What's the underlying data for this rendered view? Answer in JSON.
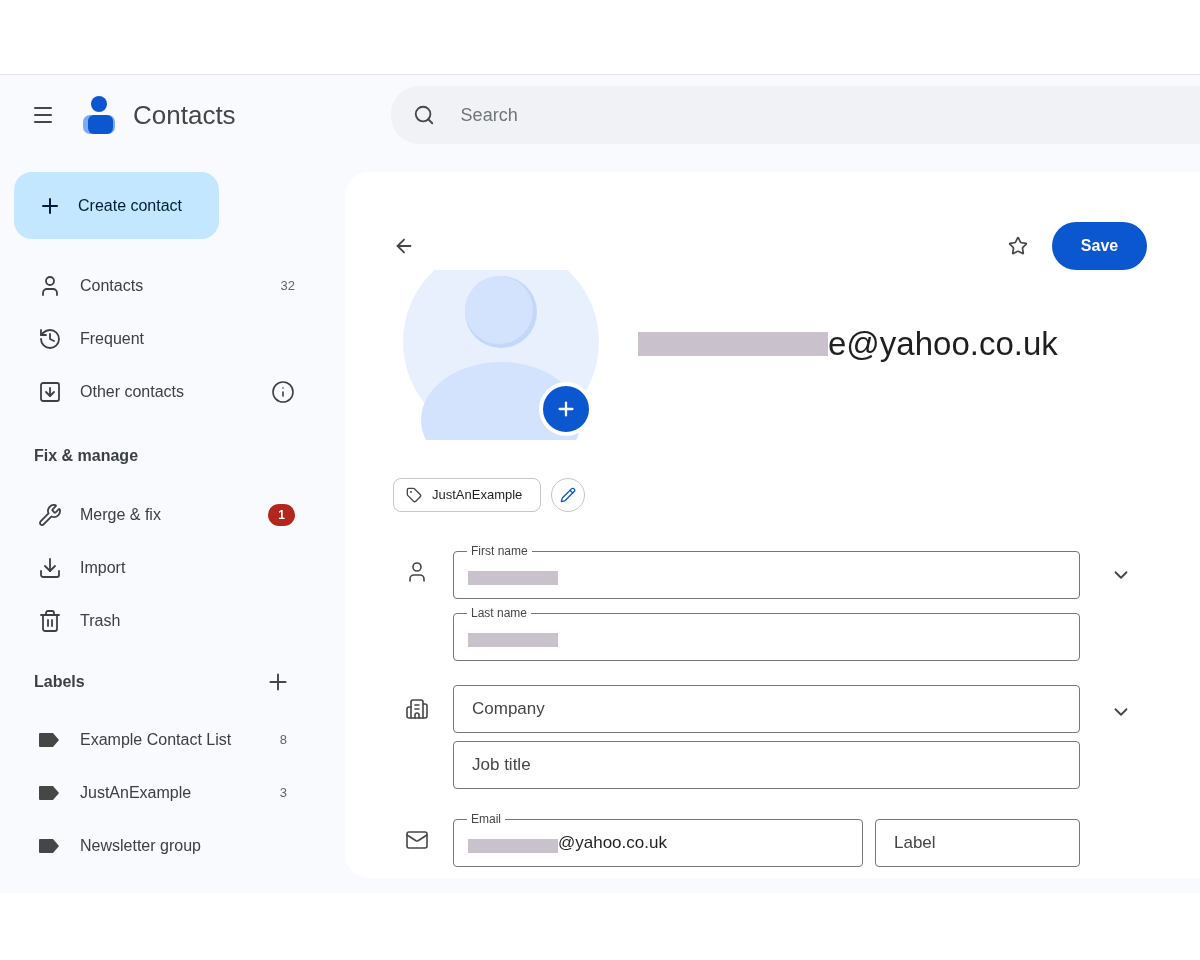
{
  "app": {
    "title": "Contacts"
  },
  "search": {
    "placeholder": "Search"
  },
  "create_button": {
    "label": "Create contact"
  },
  "nav": [
    {
      "kind": "person",
      "label": "Contacts",
      "count": "32"
    },
    {
      "kind": "history",
      "label": "Frequent"
    },
    {
      "kind": "archive",
      "label": "Other contacts",
      "info": true
    }
  ],
  "fix_section": {
    "title": "Fix & manage",
    "items": [
      {
        "kind": "merge",
        "label": "Merge & fix",
        "badge": "1"
      },
      {
        "kind": "import",
        "label": "Import"
      },
      {
        "kind": "trash",
        "label": "Trash"
      }
    ]
  },
  "labels_section": {
    "title": "Labels",
    "items": [
      {
        "label": "Example Contact List",
        "count": "8"
      },
      {
        "label": "JustAnExample",
        "count": "3"
      },
      {
        "label": "Newsletter group"
      }
    ]
  },
  "editor": {
    "title": {
      "text": "e@yahoo.co.uk",
      "redacted": true
    },
    "starred": false,
    "save_button": "Save",
    "label_chip": "JustAnExample",
    "rows": [
      {
        "kind": "person",
        "expandable": true,
        "fields": [
          {
            "label": "First name",
            "redacted": true
          }
        ]
      },
      {
        "fields": [
          {
            "label": "Last name",
            "redacted": true
          }
        ]
      },
      {
        "kind": "building",
        "expandable": true,
        "fields": [
          {
            "placeholder": "Company"
          }
        ]
      },
      {
        "fields": [
          {
            "placeholder": "Job title"
          }
        ]
      },
      {
        "kind": "mail",
        "fields": [
          {
            "label": "Email",
            "value": "@yahoo.co.uk",
            "redacted": true
          },
          {
            "placeholder": "Label"
          }
        ]
      }
    ]
  }
}
